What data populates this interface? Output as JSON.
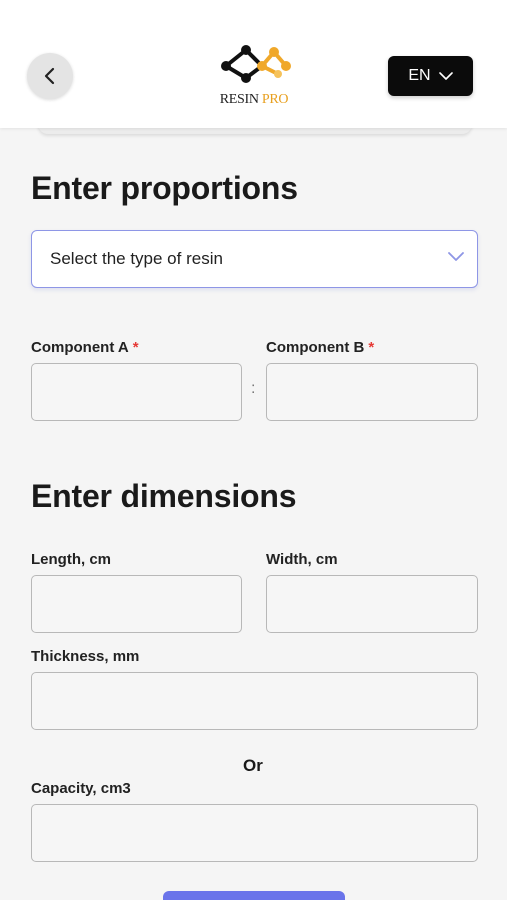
{
  "header": {
    "logo": {
      "word1": "RESIN",
      "word2": "PRO"
    },
    "language": "EN"
  },
  "proportions": {
    "title": "Enter proportions",
    "resin_select": {
      "placeholder": "Select the type of resin"
    },
    "component_a_label": "Component A",
    "component_b_label": "Component B",
    "required_mark": "*",
    "separator": ":"
  },
  "dimensions": {
    "title": "Enter dimensions",
    "length_label": "Length, cm",
    "width_label": "Width, cm",
    "thickness_label": "Thickness, mm",
    "or_text": "Or",
    "capacity_label": "Capacity, cm3"
  },
  "colors": {
    "accent": "#6a74ea",
    "select_border": "#8e96e6",
    "required": "#e53935",
    "logo_orange": "#f0a82a",
    "logo_dark": "#111111"
  }
}
